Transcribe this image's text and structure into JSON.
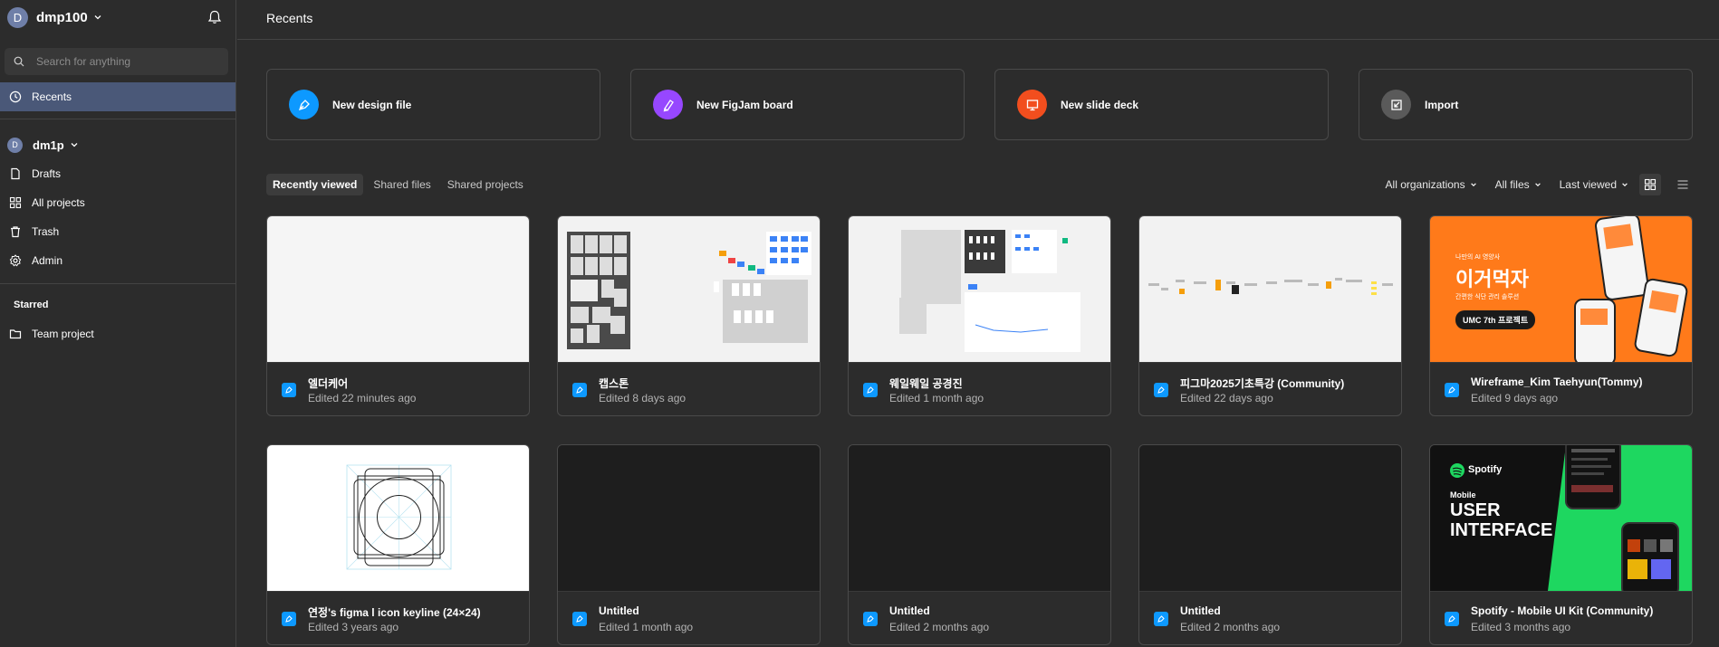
{
  "sidebar": {
    "team": {
      "initial": "D",
      "name": "dmp100"
    },
    "search_placeholder": "Search for anything",
    "recents_label": "Recents",
    "org": {
      "initial": "D",
      "name": "dm1p"
    },
    "items": [
      {
        "label": "Drafts",
        "icon": "file-icon"
      },
      {
        "label": "All projects",
        "icon": "grid-icon"
      },
      {
        "label": "Trash",
        "icon": "trash-icon"
      },
      {
        "label": "Admin",
        "icon": "gear-icon"
      }
    ],
    "starred_title": "Starred",
    "starred_items": [
      {
        "label": "Team project",
        "icon": "folder-icon"
      }
    ]
  },
  "main": {
    "title": "Recents",
    "create_cards": [
      {
        "label": "New design file",
        "icon": "pen-icon",
        "color": "#0d99ff"
      },
      {
        "label": "New FigJam board",
        "icon": "marker-icon",
        "color": "#9747ff"
      },
      {
        "label": "New slide deck",
        "icon": "slides-icon",
        "color": "#f24e1e"
      },
      {
        "label": "Import",
        "icon": "import-icon",
        "color": "#5a5a5a"
      }
    ],
    "tabs": [
      "Recently viewed",
      "Shared files",
      "Shared projects"
    ],
    "filters": [
      "All organizations",
      "All files",
      "Last viewed"
    ],
    "files": [
      {
        "name": "엘더케어",
        "edited": "Edited 22 minutes ago",
        "thumb": "blank-light"
      },
      {
        "name": "캡스톤",
        "edited": "Edited 8 days ago",
        "thumb": "capstone"
      },
      {
        "name": "웨일웨일 공경진",
        "edited": "Edited 1 month ago",
        "thumb": "whale"
      },
      {
        "name": "피그마2025기초특강 (Community)",
        "edited": "Edited 22 days ago",
        "thumb": "figma-lecture"
      },
      {
        "name": "Wireframe_Kim Taehyun(Tommy)",
        "edited": "Edited 9 days ago",
        "thumb": "orange-app",
        "thumb_text": {
          "small": "나만의 AI 영양사",
          "big": "이거먹자",
          "sub": "간편한 식단 관리 솔루션",
          "badge": "UMC 7th 프로젝트"
        }
      },
      {
        "name": "연정's figma l icon keyline (24×24)",
        "edited": "Edited 3 years ago",
        "thumb": "keyline"
      },
      {
        "name": "Untitled",
        "edited": "Edited 1 month ago",
        "thumb": "blank-dark"
      },
      {
        "name": "Untitled",
        "edited": "Edited 2 months ago",
        "thumb": "blank-dark"
      },
      {
        "name": "Untitled",
        "edited": "Edited 2 months ago",
        "thumb": "blank-dark"
      },
      {
        "name": "Spotify - Mobile UI Kit (Community)",
        "edited": "Edited 3 months ago",
        "thumb": "spotify",
        "thumb_text": {
          "brand": "Spotify",
          "line1": "Mobile",
          "line2": "USER",
          "line3": "INTERFACE"
        }
      }
    ]
  },
  "colors": {
    "sidebar_active": "#4a5878",
    "background": "#2c2c2c",
    "border": "#4a4a4a",
    "accent_blue": "#0d99ff",
    "spotify_green": "#1ed760",
    "orange": "#ff7a1a"
  }
}
